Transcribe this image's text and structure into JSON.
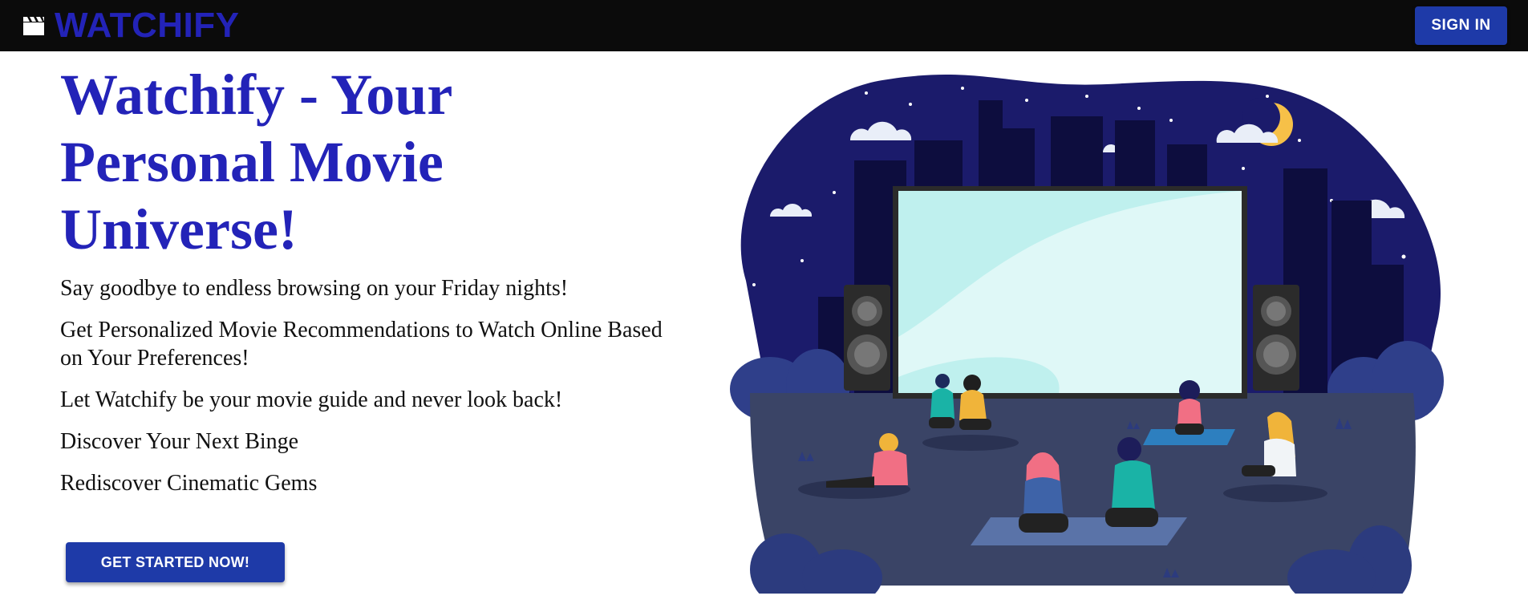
{
  "header": {
    "brand": "WATCHIFY",
    "logo_icon": "clapperboard-icon",
    "sign_in_label": "SIGN IN"
  },
  "hero": {
    "title": "Watchify - Your Personal Movie Universe!",
    "lines": [
      "Say goodbye to endless browsing on your Friday nights!",
      "Get Personalized Movie Recommendations to Watch Online Based on Your Preferences!",
      "Let Watchify be your movie guide and never look back!",
      "Discover Your Next Binge",
      "Rediscover Cinematic Gems"
    ],
    "cta_label": "GET STARTED NOW!"
  },
  "illustration": {
    "subject": "outdoor-cinema-night-illustration"
  },
  "colors": {
    "brand_blue": "#2323b8",
    "button_blue": "#1e3aa8",
    "topbar": "#0b0b0b",
    "night_sky": "#1b1b6b",
    "screen": "#bff0ee",
    "ground": "#3a4466"
  }
}
